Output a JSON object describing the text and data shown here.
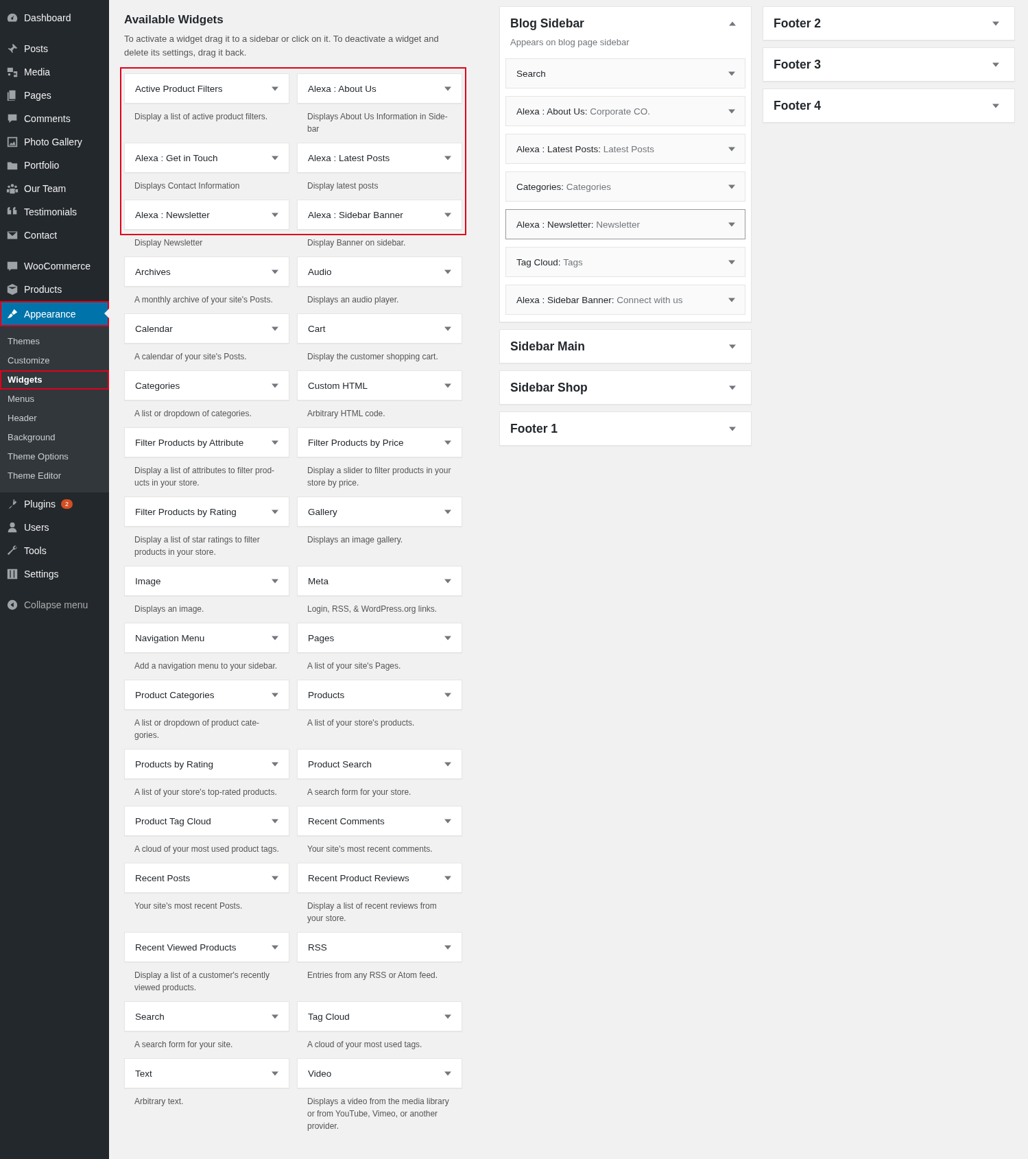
{
  "admin_menu": [
    [
      {
        "label": "Dashboard",
        "selected": false,
        "highlighted": false
      }
    ],
    [
      {
        "label": "Posts",
        "selected": false,
        "highlighted": false
      },
      {
        "label": "Media",
        "selected": false,
        "highlighted": false
      },
      {
        "label": "Pages",
        "selected": false,
        "highlighted": false
      },
      {
        "label": "Comments",
        "selected": false,
        "highlighted": false
      },
      {
        "label": "Photo Gallery",
        "selected": false,
        "highlighted": false
      },
      {
        "label": "Portfolio",
        "selected": false,
        "highlighted": false
      },
      {
        "label": "Our Team",
        "selected": false,
        "highlighted": false
      },
      {
        "label": "Testimonials",
        "selected": false,
        "highlighted": false
      },
      {
        "label": "Contact",
        "selected": false,
        "highlighted": false
      }
    ],
    [
      {
        "label": "WooCommerce",
        "selected": false,
        "highlighted": false
      },
      {
        "label": "Products",
        "selected": false,
        "highlighted": false
      },
      {
        "label": "Appearance",
        "selected": true,
        "highlighted": true,
        "children": [
          {
            "label": "Themes",
            "selected": false,
            "highlighted": false
          },
          {
            "label": "Customize",
            "selected": false,
            "highlighted": false
          },
          {
            "label": "Widgets",
            "selected": true,
            "highlighted": true
          },
          {
            "label": "Menus",
            "selected": false,
            "highlighted": false
          },
          {
            "label": "Header",
            "selected": false,
            "highlighted": false
          },
          {
            "label": "Background",
            "selected": false,
            "highlighted": false
          },
          {
            "label": "Theme Options",
            "selected": false,
            "highlighted": false
          },
          {
            "label": "Theme Editor",
            "selected": false,
            "highlighted": false
          }
        ]
      },
      {
        "label": "Plugins",
        "selected": false,
        "highlighted": false,
        "badge": "2"
      },
      {
        "label": "Users",
        "selected": false,
        "highlighted": false
      },
      {
        "label": "Tools",
        "selected": false,
        "highlighted": false
      },
      {
        "label": "Settings",
        "selected": false,
        "highlighted": false
      }
    ],
    [
      {
        "label": "Collapse menu",
        "selected": false,
        "highlighted": false
      }
    ]
  ],
  "available_widgets": {
    "title": "Available Widgets",
    "description": "To activate a widget drag it to a sidebar or click on it. To deactivate a widget and delete its settings, drag it back.",
    "widgets": [
      {
        "title": "Active Product Filters",
        "description": "Display a list of active product filters.",
        "highlighted": true
      },
      {
        "title": "Alexa : About Us",
        "description": "Displays About Us Information in Side-bar",
        "highlighted": true
      },
      {
        "title": "Alexa : Get in Touch",
        "description": "Displays Contact Information",
        "highlighted": true
      },
      {
        "title": "Alexa : Latest Posts",
        "description": "Display latest posts",
        "highlighted": true
      },
      {
        "title": "Alexa : Newsletter",
        "description": "Display Newsletter",
        "highlighted": true
      },
      {
        "title": "Alexa : Sidebar Banner",
        "description": "Display Banner on sidebar.",
        "highlighted": true
      },
      {
        "title": "Archives",
        "description": "A monthly archive of your site's Posts.",
        "highlighted": false
      },
      {
        "title": "Audio",
        "description": "Displays an audio player.",
        "highlighted": false
      },
      {
        "title": "Calendar",
        "description": "A calendar of your site's Posts.",
        "highlighted": false
      },
      {
        "title": "Cart",
        "description": "Display the customer shopping cart.",
        "highlighted": false
      },
      {
        "title": "Categories",
        "description": "A list or dropdown of categories.",
        "highlighted": false
      },
      {
        "title": "Custom HTML",
        "description": "Arbitrary HTML code.",
        "highlighted": false
      },
      {
        "title": "Filter Products by Attribute",
        "description": "Display a list of attributes to filter prod-ucts in your store.",
        "highlighted": false
      },
      {
        "title": "Filter Products by Price",
        "description": "Display a slider to filter products in your store by price.",
        "highlighted": false
      },
      {
        "title": "Filter Products by Rating",
        "description": "Display a list of star ratings to filter products in your store.",
        "highlighted": false
      },
      {
        "title": "Gallery",
        "description": "Displays an image gallery.",
        "highlighted": false
      },
      {
        "title": "Image",
        "description": "Displays an image.",
        "highlighted": false
      },
      {
        "title": "Meta",
        "description": "Login, RSS, & WordPress.org links.",
        "highlighted": false
      },
      {
        "title": "Navigation Menu",
        "description": "Add a navigation menu to your sidebar.",
        "highlighted": false
      },
      {
        "title": "Pages",
        "description": "A list of your site's Pages.",
        "highlighted": false
      },
      {
        "title": "Product Categories",
        "description": "A list or dropdown of product cate-gories.",
        "highlighted": false
      },
      {
        "title": "Products",
        "description": "A list of your store's products.",
        "highlighted": false
      },
      {
        "title": "Products by Rating",
        "description": "A list of your store's top-rated products.",
        "highlighted": false
      },
      {
        "title": "Product Search",
        "description": "A search form for your store.",
        "highlighted": false
      },
      {
        "title": "Product Tag Cloud",
        "description": "A cloud of your most used product tags.",
        "highlighted": false
      },
      {
        "title": "Recent Comments",
        "description": "Your site's most recent comments.",
        "highlighted": false
      },
      {
        "title": "Recent Posts",
        "description": "Your site's most recent Posts.",
        "highlighted": false
      },
      {
        "title": "Recent Product Reviews",
        "description": "Display a list of recent reviews from your store.",
        "highlighted": false
      },
      {
        "title": "Recent Viewed Products",
        "description": "Display a list of a customer's recently viewed products.",
        "highlighted": false
      },
      {
        "title": "RSS",
        "description": "Entries from any RSS or Atom feed.",
        "highlighted": false
      },
      {
        "title": "Search",
        "description": "A search form for your site.",
        "highlighted": false
      },
      {
        "title": "Tag Cloud",
        "description": "A cloud of your most used tags.",
        "highlighted": false
      },
      {
        "title": "Text",
        "description": "Arbitrary text.",
        "highlighted": false
      },
      {
        "title": "Video",
        "description": "Displays a video from the media library or from YouTube, Vimeo, or another provider.",
        "highlighted": false
      }
    ]
  },
  "sidebar_columns": [
    [
      {
        "title": "Blog Sidebar",
        "expanded": true,
        "description": "Appears on blog page sidebar",
        "widgets": [
          {
            "title": "Search",
            "selected": false
          },
          {
            "title": "Alexa : About Us:",
            "subtitle": "Corporate CO.",
            "selected": false
          },
          {
            "title": "Alexa : Latest Posts:",
            "subtitle": "Latest Posts",
            "selected": false
          },
          {
            "title": "Categories:",
            "subtitle": "Categories",
            "selected": false
          },
          {
            "title": "Alexa : Newsletter:",
            "subtitle": "Newsletter",
            "selected": true
          },
          {
            "title": "Tag Cloud:",
            "subtitle": "Tags",
            "selected": false
          },
          {
            "title": "Alexa : Sidebar Banner:",
            "subtitle": "Connect with us",
            "selected": false
          }
        ]
      },
      {
        "title": "Sidebar Main",
        "expanded": false
      },
      {
        "title": "Sidebar Shop",
        "expanded": false
      },
      {
        "title": "Footer 1",
        "expanded": false
      }
    ],
    [
      {
        "title": "Footer 2",
        "expanded": false
      },
      {
        "title": "Footer 3",
        "expanded": false
      },
      {
        "title": "Footer 4",
        "expanded": false
      }
    ]
  ]
}
